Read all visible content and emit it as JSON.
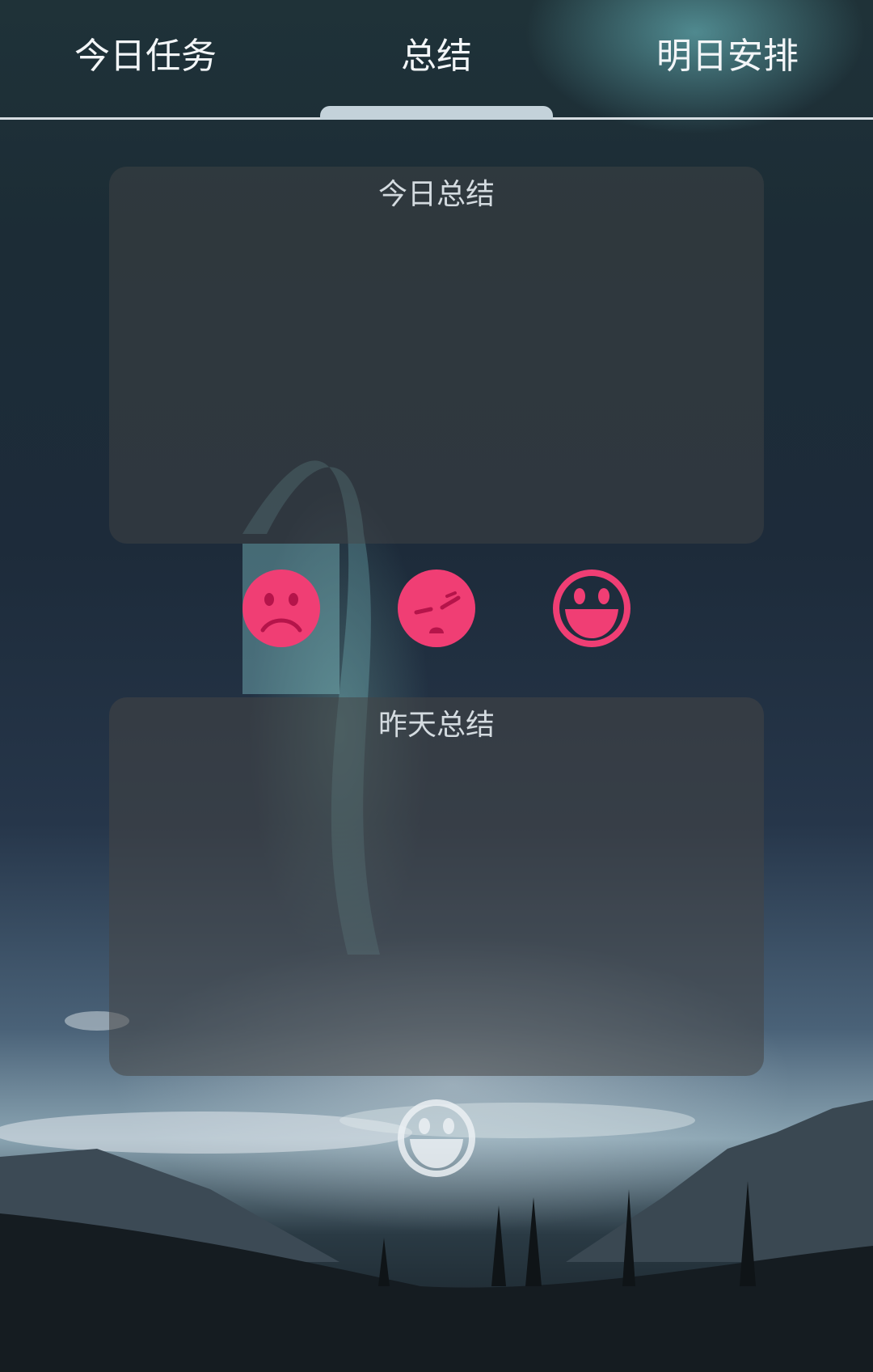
{
  "tabs": [
    {
      "label": "今日任务",
      "active": false
    },
    {
      "label": "总结",
      "active": true
    },
    {
      "label": "明日安排",
      "active": false
    }
  ],
  "today_summary": {
    "title": "今日总结",
    "text": ""
  },
  "mood_options": [
    {
      "icon": "sad-face-icon"
    },
    {
      "icon": "tired-face-icon"
    },
    {
      "icon": "happy-face-icon"
    }
  ],
  "yesterday_summary": {
    "title": "昨天总结",
    "text": "",
    "mood_icon": "happy-face-icon"
  },
  "colors": {
    "mood_accent": "#f03e74",
    "yesterday_mood": "#e6ebee",
    "tab_text": "#f3f6f8",
    "tab_indicator": "#c4d2da"
  }
}
